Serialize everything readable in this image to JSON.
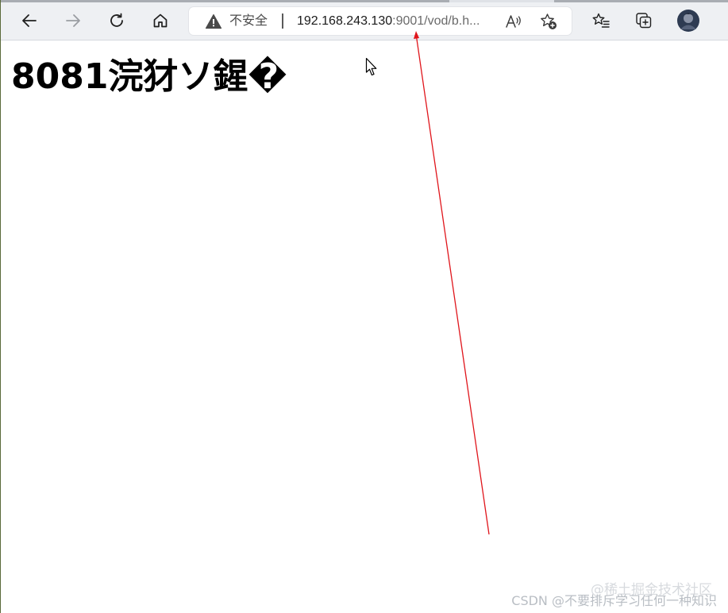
{
  "browser": {
    "nav": {
      "back_icon": "back-arrow-icon",
      "forward_icon": "forward-arrow-icon",
      "refresh_icon": "refresh-icon",
      "home_icon": "home-icon"
    },
    "addressbar": {
      "security_icon": "warning-triangle-icon",
      "security_label": "不安全",
      "url_host": "192.168.243.130",
      "url_rest": ":9001/vod/b.h...",
      "read_aloud_icon": "read-aloud-icon",
      "add_favorite_icon": "add-favorite-icon"
    },
    "toolbar_right": {
      "favorites_icon": "favorites-icon",
      "collections_icon": "collections-icon",
      "profile_icon": "profile-avatar"
    }
  },
  "page": {
    "heading": "8081浣犲ソ鍟�"
  },
  "annotation": {
    "arrow_color": "#e0151b"
  },
  "watermarks": {
    "juejin": "@稀土掘金技术社区",
    "csdn": "CSDN @不要排斥学习任何一种知识"
  },
  "colors": {
    "toolbar_bg": "#eef0f3",
    "addressbar_bg": "#ffffff",
    "heading_text": "#000000"
  }
}
